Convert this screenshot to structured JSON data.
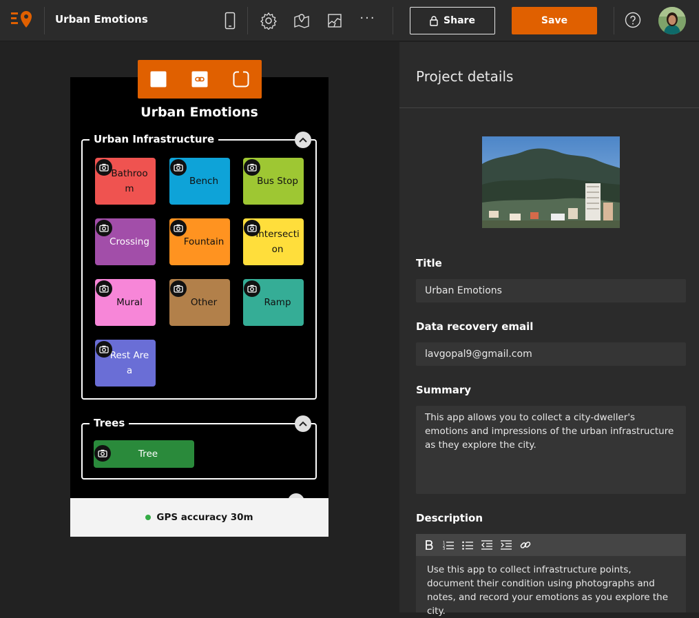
{
  "header": {
    "app_title": "Urban Emotions",
    "icons": [
      "logo-icon",
      "phone-preview-icon",
      "settings-gear-icon",
      "map-icon",
      "map-area-icon",
      "more-icon"
    ],
    "more_label": "···",
    "share_label": "Share",
    "save_label": "Save",
    "accent_color": "#e06000"
  },
  "preview": {
    "toolbar_icons": [
      "square-icon",
      "link-icon",
      "rounded-frame-icon"
    ],
    "form_title": "Urban Emotions",
    "groups": [
      {
        "label": "Urban Infrastructure",
        "items": [
          {
            "label": "Bathroom",
            "color": "#ef5350"
          },
          {
            "label": "Bench",
            "color": "#0ea3d8"
          },
          {
            "label": "Bus Stop",
            "color": "#9ec733"
          },
          {
            "label": "Crossing",
            "color": "#a24ea9"
          },
          {
            "label": "Fountain",
            "color": "#ff9320"
          },
          {
            "label": "Intersection",
            "color": "#ffde3b"
          },
          {
            "label": "Mural",
            "color": "#f786d8"
          },
          {
            "label": "Other",
            "color": "#b2804a"
          },
          {
            "label": "Ramp",
            "color": "#35ad96"
          },
          {
            "label": "Rest Area",
            "color": "#6a6ed6"
          }
        ]
      },
      {
        "label": "Trees",
        "items": [
          {
            "label": "Tree",
            "color": "#2a8a3b"
          }
        ]
      }
    ],
    "gps_text": "GPS accuracy 30m",
    "gps_color": "#35ac46"
  },
  "panel": {
    "title": "Project details",
    "title_label": "Title",
    "title_value": "Urban Emotions",
    "email_label": "Data recovery email",
    "email_value": "lavgopal9@gmail.com",
    "summary_label": "Summary",
    "summary_value": "This app allows you to collect a city-dweller's emotions and impressions of the urban infrastructure as they explore the city.",
    "description_label": "Description",
    "rte_icons": [
      "bold-icon",
      "numbered-list-icon",
      "bullet-list-icon",
      "outdent-icon",
      "indent-icon",
      "link-icon"
    ],
    "description_value": "Use this app to collect infrastructure points, document their condition using photographs and notes, and record your emotions as you explore the city."
  }
}
